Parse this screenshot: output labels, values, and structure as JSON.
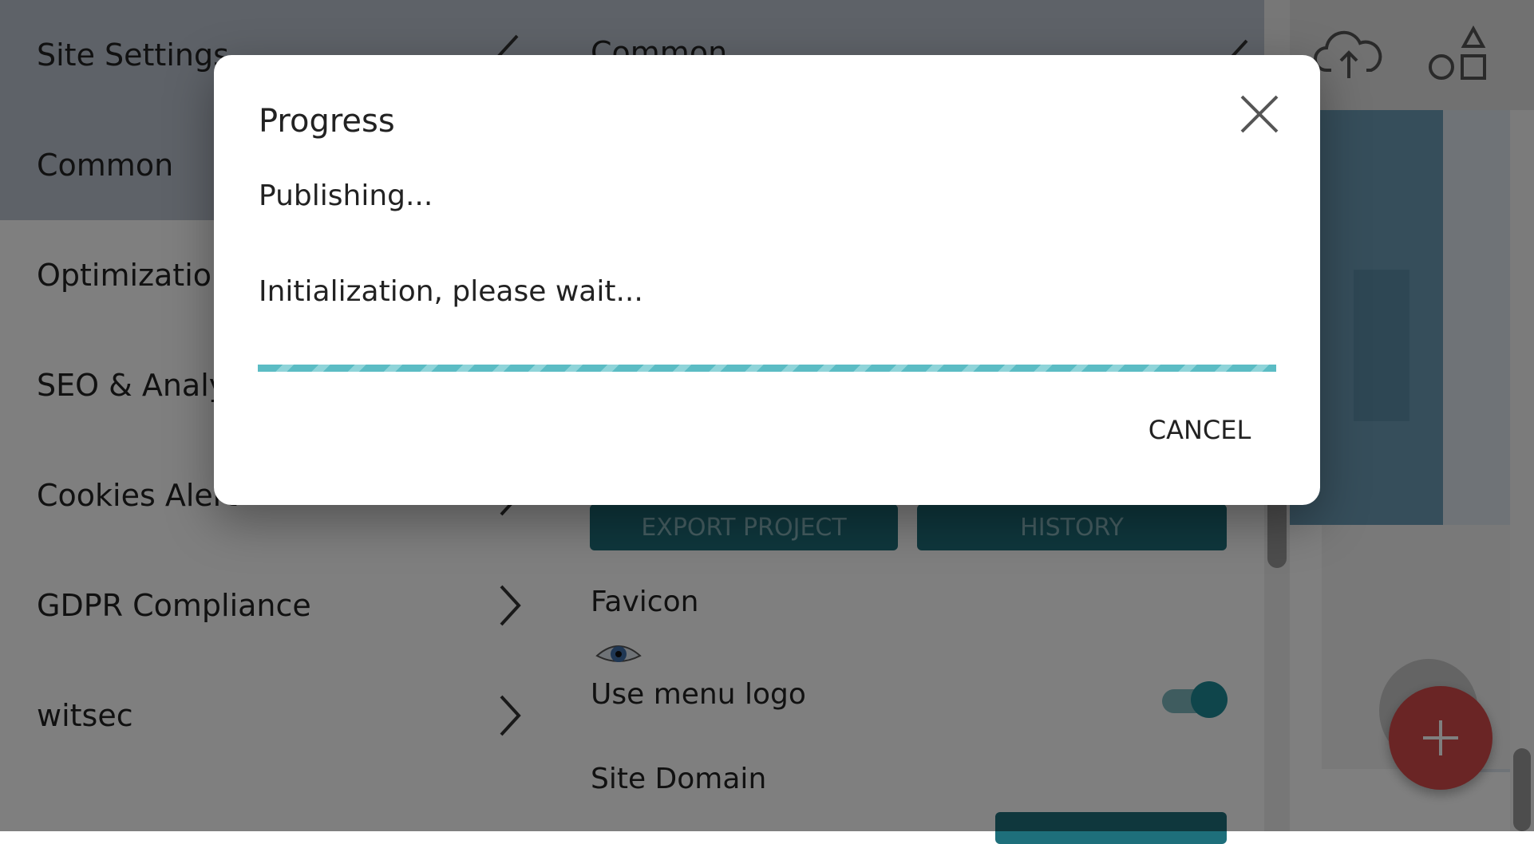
{
  "menu": {
    "items": [
      {
        "label": "Site Settings",
        "active": true
      },
      {
        "label": "Common",
        "active": true
      },
      {
        "label": "Optimization",
        "active": false
      },
      {
        "label": "SEO & Analytics",
        "active": false
      },
      {
        "label": "Cookies Alert",
        "active": false
      },
      {
        "label": "GDPR Compliance",
        "active": false
      },
      {
        "label": "witsec",
        "active": false
      }
    ]
  },
  "settings": {
    "title": "Common",
    "export_label": "EXPORT PROJECT",
    "history_label": "HISTORY",
    "favicon_label": "Favicon",
    "use_menu_logo_label": "Use menu logo",
    "use_menu_logo_on": true,
    "site_domain_label": "Site Domain"
  },
  "toolbar": {
    "icons": [
      "cloud-upload-icon",
      "shapes-icon"
    ]
  },
  "fab": {
    "icon": "plus-icon",
    "color": "#d54a4a"
  },
  "modal": {
    "title": "Progress",
    "status": "Publishing...",
    "message": "Initialization, please wait...",
    "progress": 1.0,
    "cancel_label": "CANCEL"
  },
  "colors": {
    "accent": "#1e6f7b",
    "progress": "#5bbcc4",
    "active_menu_bg": "#bcc4d1"
  }
}
